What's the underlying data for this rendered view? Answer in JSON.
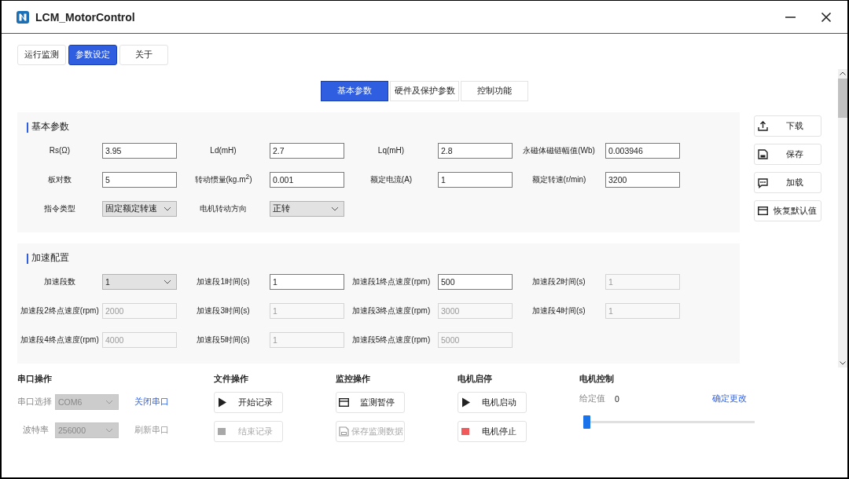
{
  "window": {
    "title": "LCM_MotorControl"
  },
  "tabs": [
    {
      "label": "运行监测",
      "selected": false
    },
    {
      "label": "参数设定",
      "selected": true
    },
    {
      "label": "关于",
      "selected": false
    }
  ],
  "sub_tabs": [
    {
      "label": "基本参数",
      "selected": true
    },
    {
      "label": "硬件及保护参数",
      "selected": false
    },
    {
      "label": "控制功能",
      "selected": false
    }
  ],
  "sections": [
    {
      "title": "基本参数",
      "rows": [
        [
          {
            "label": "Rs(Ω)",
            "kind": "input",
            "value": "3.95",
            "disabled": false
          },
          {
            "label": "Ld(mH)",
            "kind": "input",
            "value": "2.7",
            "disabled": false
          },
          {
            "label": "Lq(mH)",
            "kind": "input",
            "value": "2.8",
            "disabled": false
          },
          {
            "label": "永磁体磁链幅值(Wb)",
            "kind": "input",
            "value": "0.003946",
            "disabled": false
          }
        ],
        [
          {
            "label": "板对数",
            "kind": "input",
            "value": "5",
            "disabled": false
          },
          {
            "label": "转动惯量(kg.m$^{2}$)",
            "kind": "input",
            "value": "0.001",
            "disabled": false
          },
          {
            "label": "额定电流(A)",
            "kind": "input",
            "value": "1",
            "disabled": false
          },
          {
            "label": "额定转速(r/min)",
            "kind": "input",
            "value": "3200",
            "disabled": false
          }
        ],
        [
          {
            "label": "指令类型",
            "kind": "select",
            "value": "固定额定转速",
            "disabled": false
          },
          {
            "label": "电机转动方向",
            "kind": "select",
            "value": "正转",
            "disabled": false
          }
        ]
      ]
    },
    {
      "title": "加速配置",
      "rows": [
        [
          {
            "label": "加速段数",
            "kind": "select",
            "value": "1",
            "disabled": false
          },
          {
            "label": "加速段1时间(s)",
            "kind": "input",
            "value": "1",
            "disabled": false
          },
          {
            "label": "加速段1终点速度(rpm)",
            "kind": "input",
            "value": "500",
            "disabled": false
          },
          {
            "label": "加速段2时间(s)",
            "kind": "input",
            "value": "1",
            "disabled": true
          }
        ],
        [
          {
            "label": "加速段2终点速度(rpm)",
            "kind": "input",
            "value": "2000",
            "disabled": true
          },
          {
            "label": "加速段3时间(s)",
            "kind": "input",
            "value": "1",
            "disabled": true
          },
          {
            "label": "加速段3终点速度(rpm)",
            "kind": "input",
            "value": "3000",
            "disabled": true
          },
          {
            "label": "加速段4时间(s)",
            "kind": "input",
            "value": "1",
            "disabled": true
          }
        ],
        [
          {
            "label": "加速段4终点速度(rpm)",
            "kind": "input",
            "value": "4000",
            "disabled": true
          },
          {
            "label": "加速段5时间(s)",
            "kind": "input",
            "value": "1",
            "disabled": true
          },
          {
            "label": "加速段5终点速度(rpm)",
            "kind": "input",
            "value": "5000",
            "disabled": true
          }
        ]
      ]
    }
  ],
  "actions": [
    {
      "label": "下载"
    },
    {
      "label": "保存"
    },
    {
      "label": "加载"
    },
    {
      "label": "恢复默认值"
    }
  ],
  "bottom": {
    "serial": {
      "title": "串口操作",
      "rows": [
        {
          "label": "串口选择",
          "value": "COM6",
          "disabled": true,
          "link": {
            "label": "关闭串口",
            "disabled": false
          }
        },
        {
          "label": "波特率",
          "value": "256000",
          "disabled": true,
          "link": {
            "label": "刷新串口",
            "disabled": true
          }
        }
      ]
    },
    "file": {
      "title": "文件操作",
      "buttons": [
        {
          "label": "开始记录",
          "disabled": false
        },
        {
          "label": "结束记录",
          "disabled": true
        }
      ]
    },
    "monitor": {
      "title": "监控操作",
      "buttons": [
        {
          "label": "监测暂停",
          "disabled": false
        },
        {
          "label": "保存监测数据",
          "disabled": true
        }
      ]
    },
    "motor": {
      "title": "电机启停",
      "buttons": [
        {
          "label": "电机启动",
          "disabled": false
        },
        {
          "label": "电机停止",
          "disabled": false
        }
      ]
    },
    "control": {
      "title": "电机控制",
      "setpoint_label": "给定值",
      "setpoint_value": "0",
      "link": "确定更改",
      "slider": {
        "level": 0
      }
    }
  }
}
